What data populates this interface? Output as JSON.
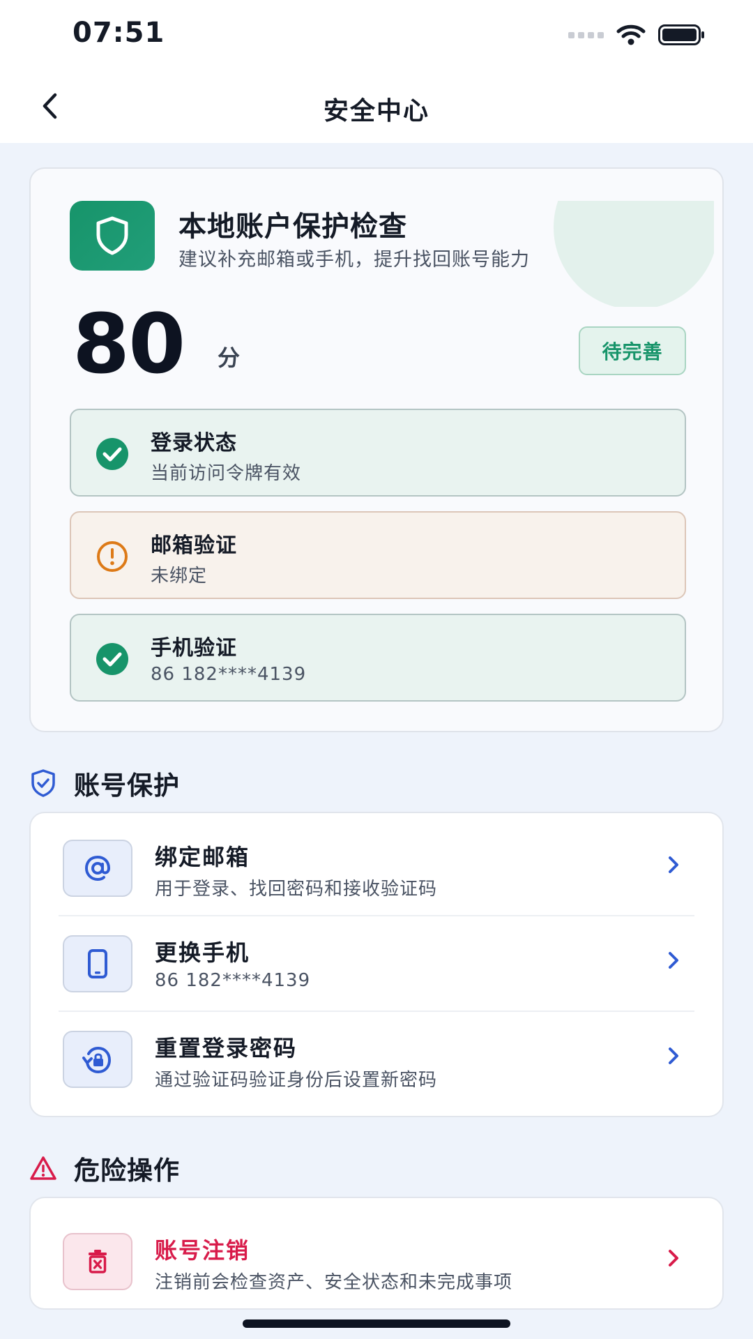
{
  "status_bar": {
    "time": "07:51"
  },
  "nav": {
    "title": "安全中心"
  },
  "score_card": {
    "title": "本地账户保护检查",
    "subtitle": "建议补充邮箱或手机，提升找回账号能力",
    "score": "80",
    "unit": "分",
    "status": "待完善",
    "checks": [
      {
        "title": "登录状态",
        "desc": "当前访问令牌有效",
        "state": "ok"
      },
      {
        "title": "邮箱验证",
        "desc": "未绑定",
        "state": "warning"
      },
      {
        "title": "手机验证",
        "desc": "86 182****4139",
        "state": "ok"
      }
    ]
  },
  "account_protection": {
    "heading": "账号保护",
    "items": [
      {
        "title": "绑定邮箱",
        "desc": "用于登录、找回密码和接收验证码",
        "icon": "at-sign-icon"
      },
      {
        "title": "更换手机",
        "desc": "86 182****4139",
        "icon": "phone-icon"
      },
      {
        "title": "重置登录密码",
        "desc": "通过验证码验证身份后设置新密码",
        "icon": "lock-reset-icon"
      }
    ]
  },
  "danger_zone": {
    "heading": "危险操作",
    "items": [
      {
        "title": "账号注销",
        "desc": "注销前会检查资产、安全状态和未完成事项",
        "icon": "delete-account-icon"
      }
    ]
  },
  "colors": {
    "accent_green": "#17946a",
    "accent_blue": "#2f5bd3",
    "danger_red": "#d81b4a",
    "warning_orange": "#dd7a17",
    "page_background": "#eef3fb"
  }
}
